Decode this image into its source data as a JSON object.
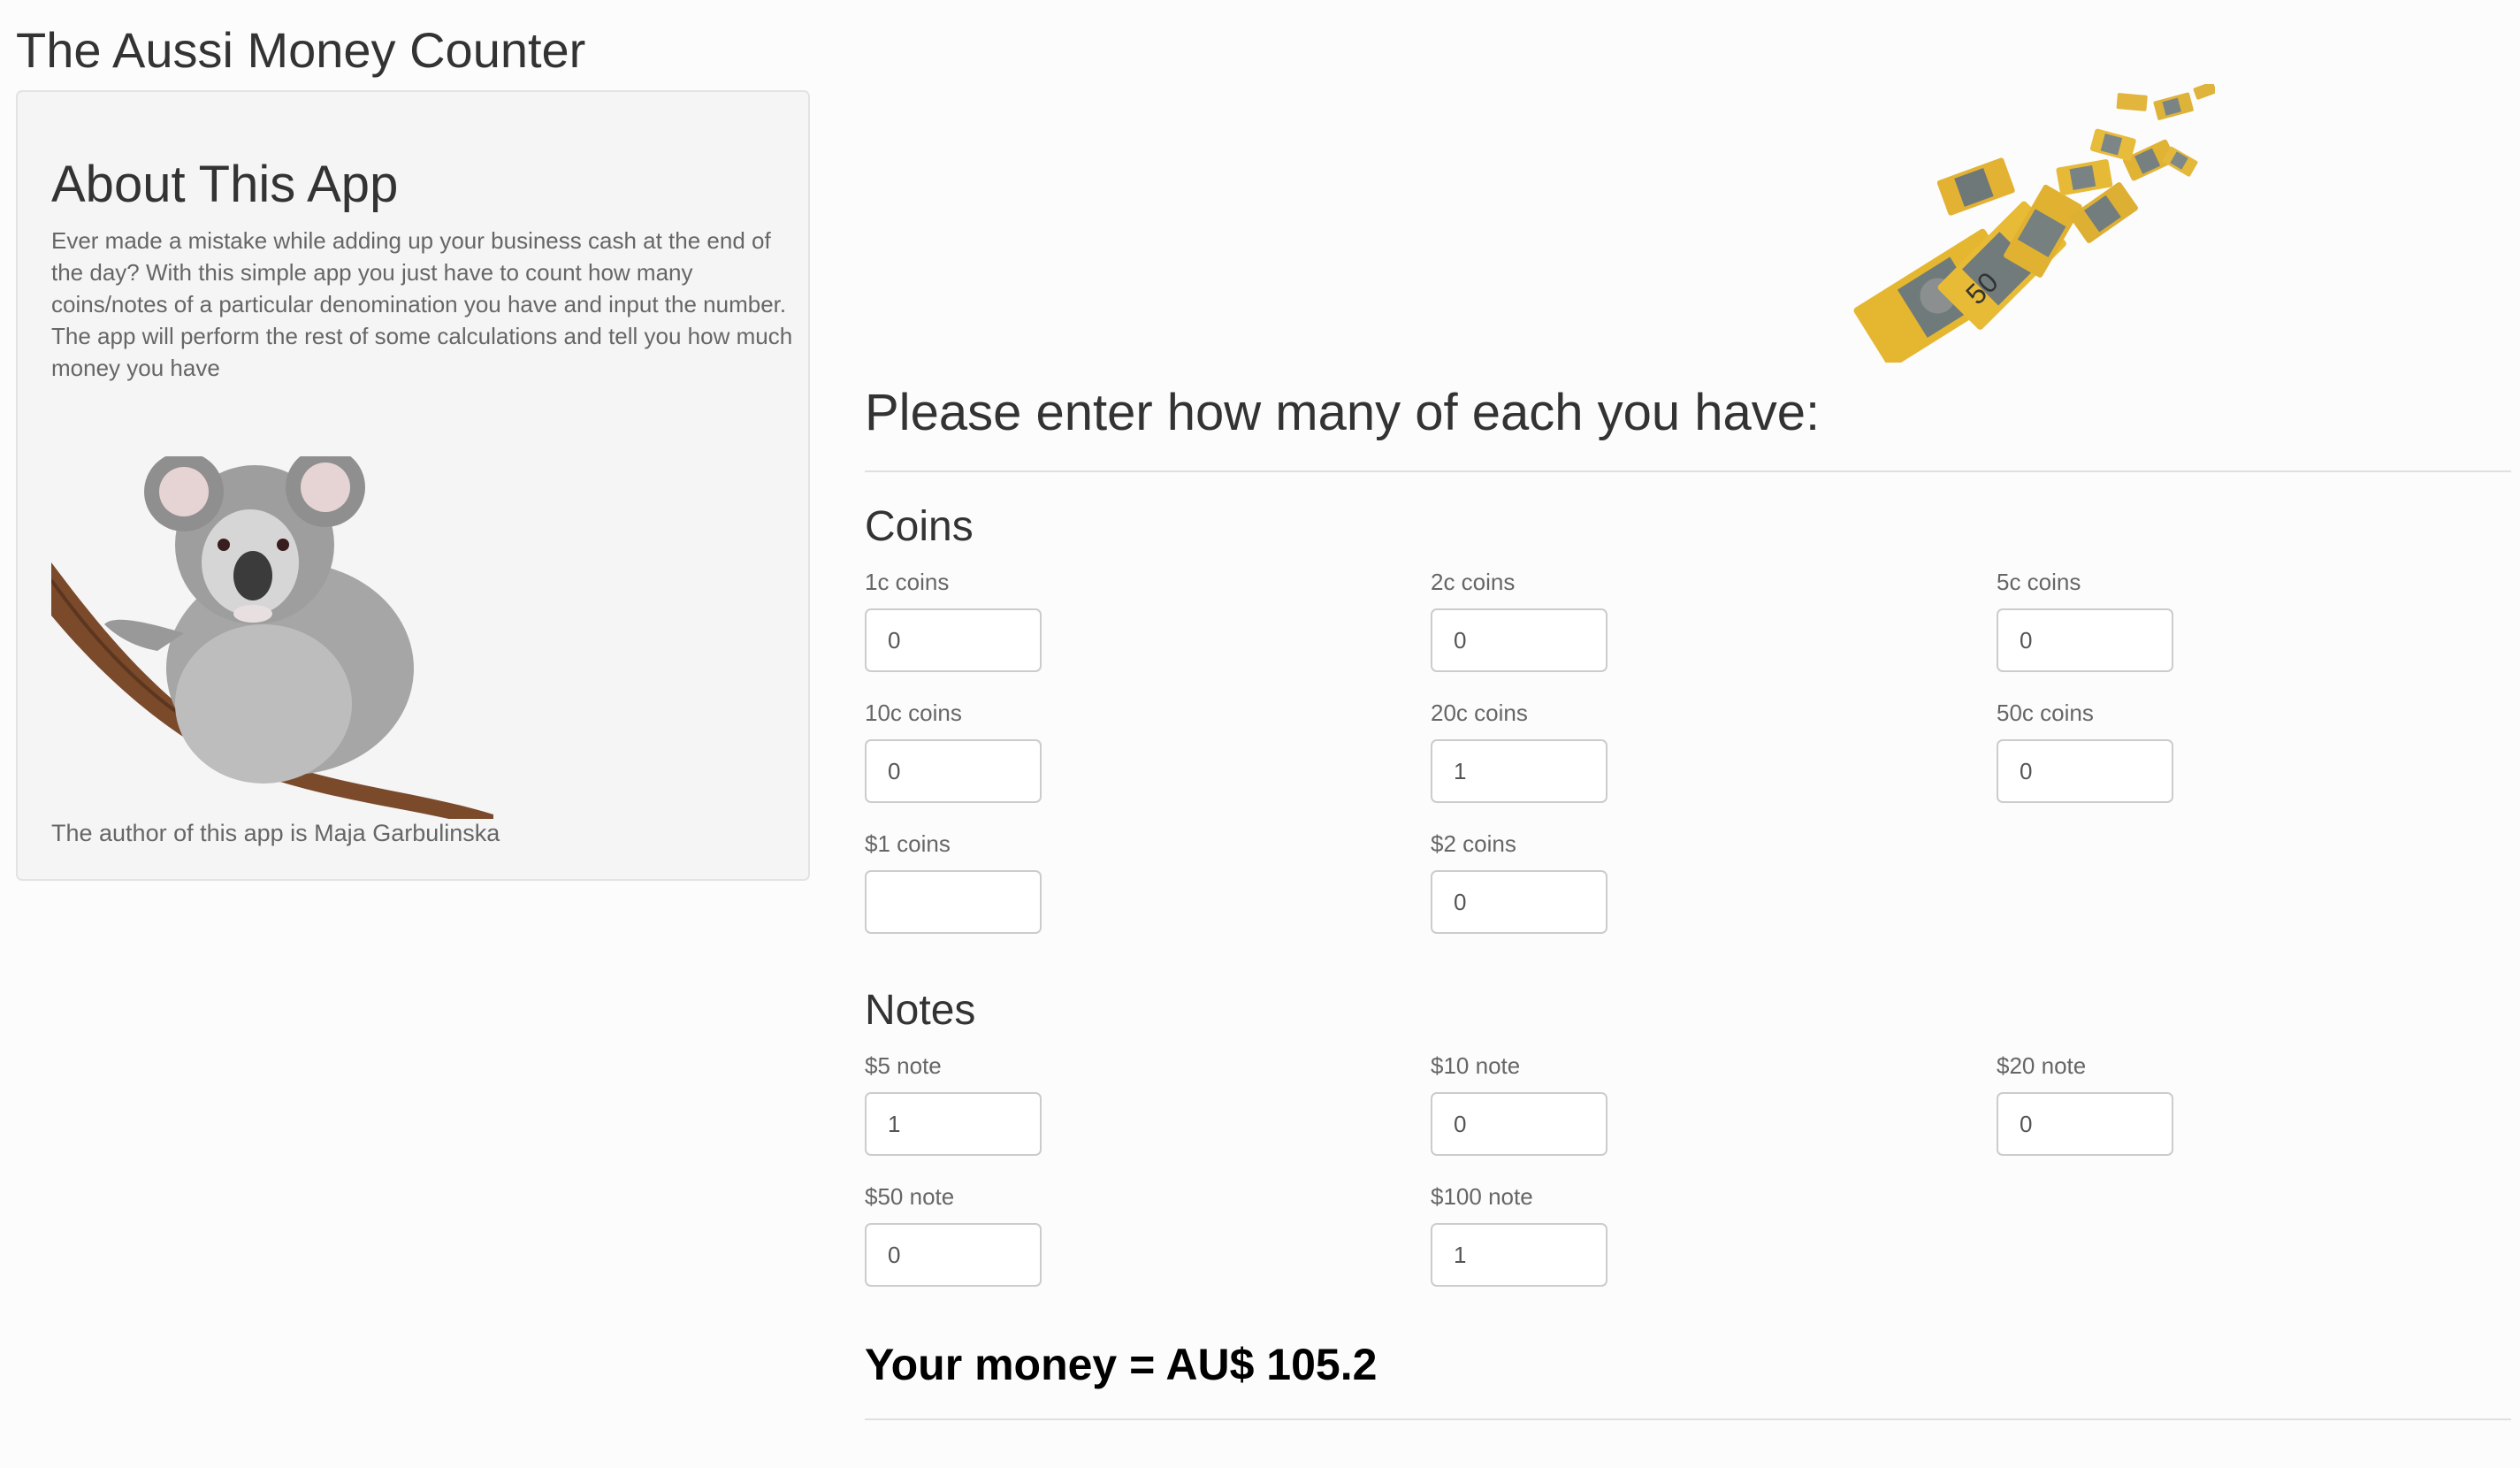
{
  "app": {
    "title": "The Aussi Money Counter"
  },
  "sidebar": {
    "heading": "About This App",
    "description": "Ever made a mistake while adding up your business cash at the end of the day? With this simple app you just have to count how many coins/notes of a particular denomination you have and input the number. The app will perform the rest of some calculations and tell you how much money you have",
    "author": "The author of this app is Maja Garbulinska"
  },
  "main": {
    "prompt": "Please enter how many of each you have:",
    "coins": {
      "title": "Coins",
      "fields": [
        {
          "label": "1c coins",
          "value": "0"
        },
        {
          "label": "2c coins",
          "value": "0"
        },
        {
          "label": "5c coins",
          "value": "0"
        },
        {
          "label": "10c coins",
          "value": "0"
        },
        {
          "label": "20c coins",
          "value": "1"
        },
        {
          "label": "50c coins",
          "value": "0"
        },
        {
          "label": "$1 coins",
          "value": ""
        },
        {
          "label": "$2 coins",
          "value": "0"
        }
      ]
    },
    "notes": {
      "title": "Notes",
      "fields": [
        {
          "label": "$5 note",
          "value": "1"
        },
        {
          "label": "$10 note",
          "value": "0"
        },
        {
          "label": "$20 note",
          "value": "0"
        },
        {
          "label": "$50 note",
          "value": "0"
        },
        {
          "label": "$100 note",
          "value": "1"
        }
      ]
    },
    "result": "Your money = AU$ 105.2"
  },
  "icons": {
    "koala": "koala-image",
    "money": "banknotes-image"
  },
  "colors": {
    "background": "#fcfcfc",
    "sidebar_bg": "#f5f5f5",
    "banknote_yellow": "#e8b830"
  }
}
